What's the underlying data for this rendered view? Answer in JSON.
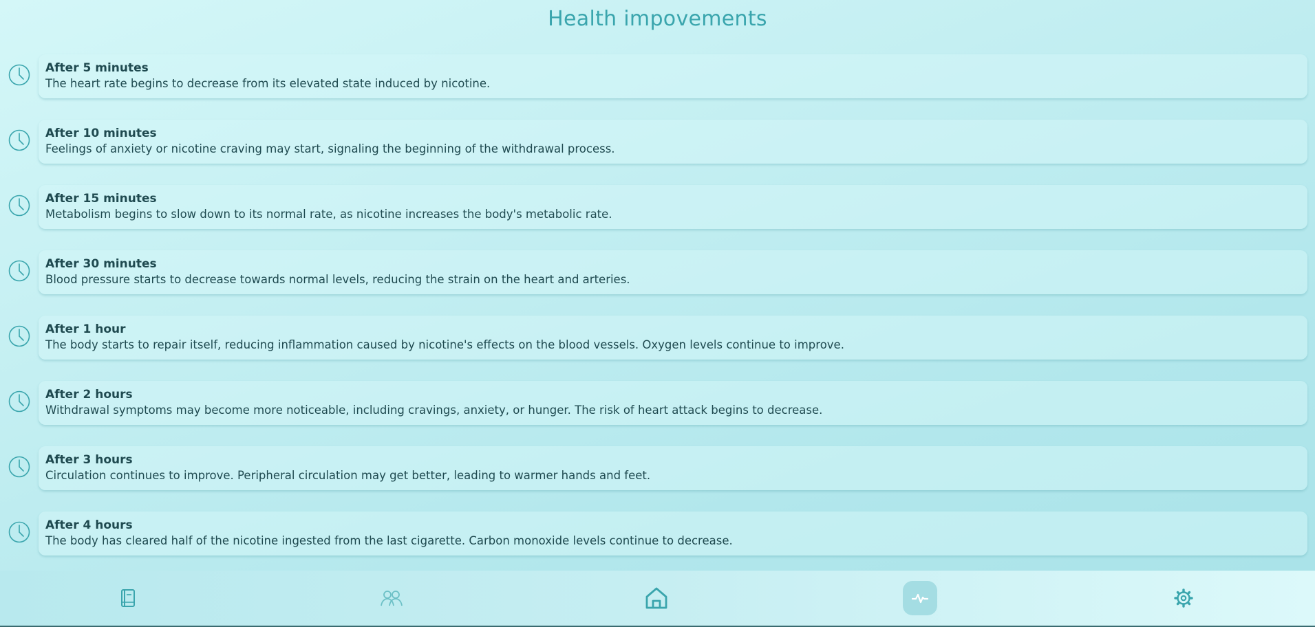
{
  "header": {
    "title": "Health impovements"
  },
  "milestones": [
    {
      "title": "After 5 minutes",
      "description": "The heart rate begins to decrease from its elevated state induced by nicotine."
    },
    {
      "title": "After 10 minutes",
      "description": "Feelings of anxiety or nicotine craving may start, signaling the beginning of the withdrawal process."
    },
    {
      "title": "After 15 minutes",
      "description": "Metabolism begins to slow down to its normal rate, as nicotine increases the body's metabolic rate."
    },
    {
      "title": "After 30 minutes",
      "description": "Blood pressure starts to decrease towards normal levels, reducing the strain on the heart and arteries."
    },
    {
      "title": "After 1 hour",
      "description": "The body starts to repair itself, reducing inflammation caused by nicotine's effects on the blood vessels. Oxygen levels continue to improve."
    },
    {
      "title": "After 2 hours",
      "description": "Withdrawal symptoms may become more noticeable, including cravings, anxiety, or hunger. The risk of heart attack begins to decrease."
    },
    {
      "title": "After 3 hours",
      "description": "Circulation continues to improve. Peripheral circulation may get better, leading to warmer hands and feet."
    },
    {
      "title": "After 4 hours",
      "description": "The body has cleared half of the nicotine ingested from the last cigarette. Carbon monoxide levels continue to decrease."
    }
  ],
  "nav": {
    "items": [
      {
        "icon": "book-icon",
        "active": false
      },
      {
        "icon": "community-icon",
        "active": false
      },
      {
        "icon": "home-icon",
        "active": false
      },
      {
        "icon": "activity-icon",
        "active": true
      },
      {
        "icon": "gear-icon",
        "active": false
      }
    ]
  },
  "colors": {
    "accent": "#3aa5ad",
    "text": "#1f4a50",
    "active_nav_bg": "#96d6dc"
  }
}
